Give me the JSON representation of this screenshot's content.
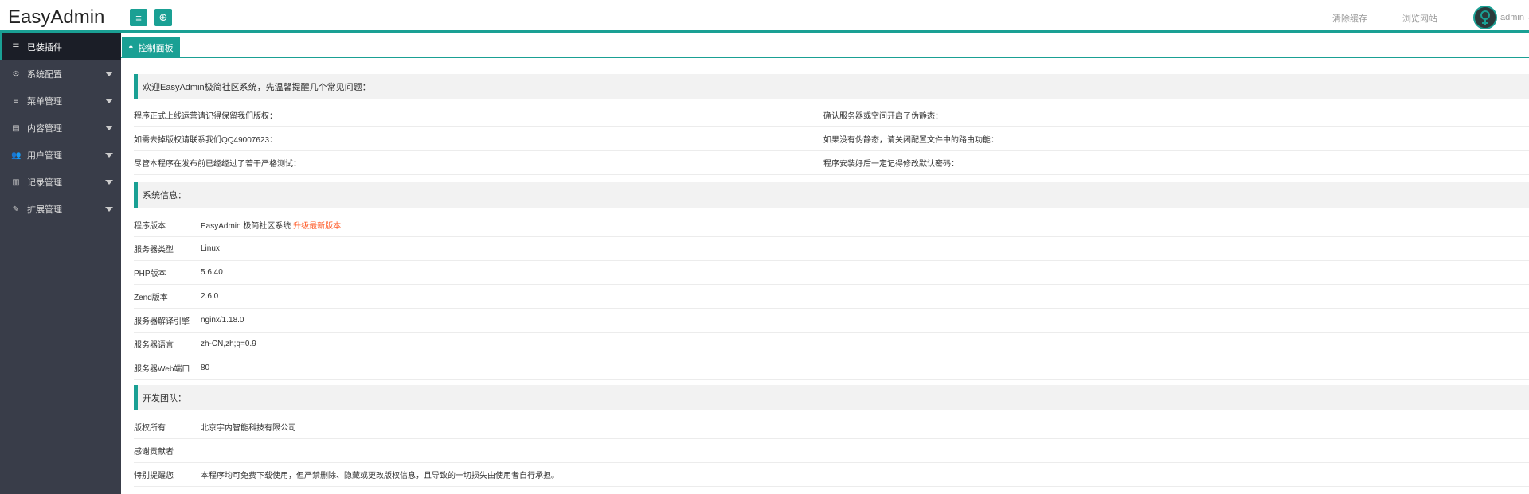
{
  "header": {
    "logo": "EasyAdmin",
    "buttons": [
      {
        "icon": "menu-icon",
        "glyph": "≡"
      },
      {
        "icon": "refresh-icon",
        "glyph": "⊕"
      }
    ],
    "links": [
      "清除缓存",
      "浏览网站"
    ],
    "user": "admin"
  },
  "sidebar": {
    "items": [
      {
        "label": "已装插件",
        "icon": "sliders-icon",
        "glyph": "☰",
        "active": true
      },
      {
        "label": "系统配置",
        "icon": "gears-icon",
        "glyph": "⚙"
      },
      {
        "label": "菜单管理",
        "icon": "list-icon",
        "glyph": "≡"
      },
      {
        "label": "内容管理",
        "icon": "file-icon",
        "glyph": "▤"
      },
      {
        "label": "用户管理",
        "icon": "users-icon",
        "glyph": "👥"
      },
      {
        "label": "记录管理",
        "icon": "barcode-icon",
        "glyph": "▥"
      },
      {
        "label": "扩展管理",
        "icon": "wrench-icon",
        "glyph": "✎"
      }
    ]
  },
  "tab": {
    "label": "控制面板",
    "icon": "dashboard-icon"
  },
  "welcome": {
    "title": "欢迎EasyAdmin极简社区系统，先温馨提醒几个常见问题：",
    "rows": [
      {
        "left": "程序正式上线运营请记得保留我们版权：",
        "right": "确认服务器或空间开启了伪静态："
      },
      {
        "left": "如需去掉版权请联系我们QQ49007623：",
        "right": "如果没有伪静态，请关闭配置文件中的路由功能："
      },
      {
        "left": "尽管本程序在发布前已经经过了若干严格测试：",
        "right": "程序安装好后一定记得修改默认密码："
      }
    ]
  },
  "sysinfo": {
    "title": "系统信息：",
    "rows": [
      {
        "key": "程序版本",
        "value": "EasyAdmin 极简社区系统",
        "extra": "升级最新版本"
      },
      {
        "key": "服务器类型",
        "value": "Linux"
      },
      {
        "key": "PHP版本",
        "value": "5.6.40"
      },
      {
        "key": "Zend版本",
        "value": "2.6.0"
      },
      {
        "key": "服务器解译引擎",
        "value": "nginx/1.18.0"
      },
      {
        "key": "服务器语言",
        "value": "zh-CN,zh;q=0.9"
      },
      {
        "key": "服务器Web端口",
        "value": "80"
      }
    ]
  },
  "team": {
    "title": "开发团队：",
    "rows": [
      {
        "key": "版权所有",
        "value": "北京宇内智能科技有限公司"
      },
      {
        "key": "感谢贡献者",
        "value": ""
      },
      {
        "key": "特别提醒您",
        "value": "本程序均可免费下载使用，但严禁删除、隐藏或更改版权信息，且导致的一切损失由使用者自行承担。"
      }
    ]
  },
  "colors": {
    "accent": "#1aa094",
    "sidebar": "#393d49",
    "link_red": "#ff5722"
  }
}
